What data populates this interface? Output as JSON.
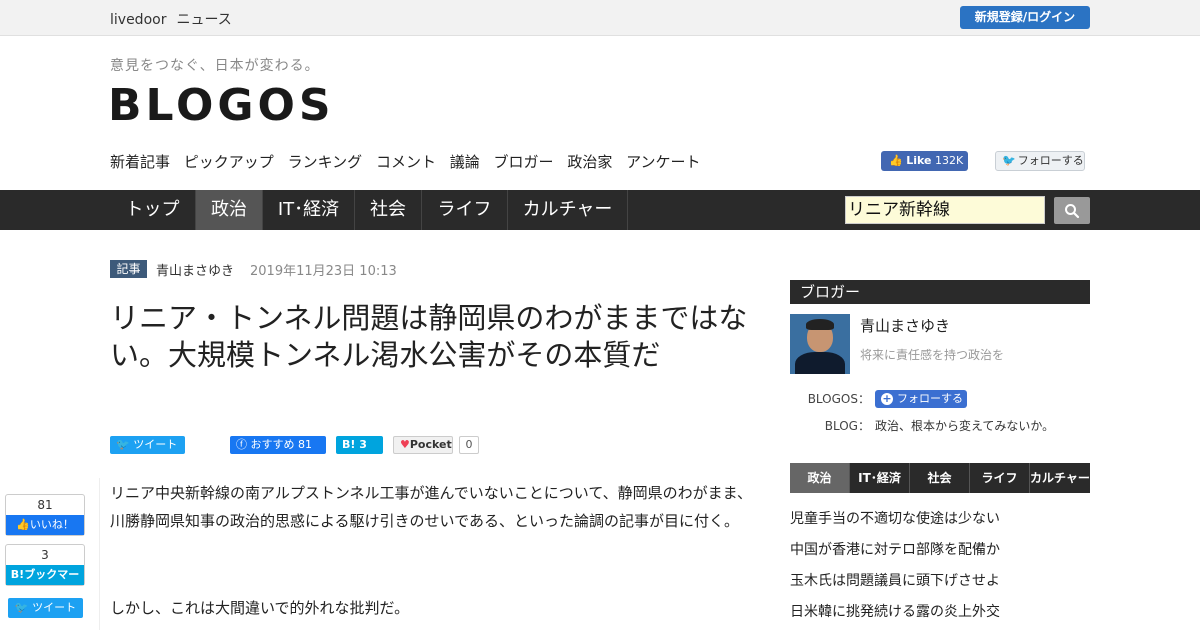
{
  "topbar": {
    "brand": "livedoor",
    "brand_sub": "ニュース",
    "login": "新規登録/ログイン"
  },
  "header": {
    "tagline": "意見をつなぐ、日本が変わる。",
    "logo": "BLOGOS",
    "nav": [
      "新着記事",
      "ピックアップ",
      "ランキング",
      "コメント",
      "議論",
      "ブロガー",
      "政治家",
      "アンケート"
    ],
    "fb_like_label": "Like",
    "fb_like_count": "132K",
    "tw_follow": "フォローする"
  },
  "categories": [
    "トップ",
    "政治",
    "IT･経済",
    "社会",
    "ライフ",
    "カルチャー"
  ],
  "search": {
    "value": "リニア新幹線"
  },
  "article": {
    "tag": "記事",
    "author": "青山まさゆき",
    "date": "2019年11月23日 10:13",
    "title": "リニア・トンネル問題は静岡県のわがままではない。大規模トンネル渇水公害がその本質だ",
    "share": {
      "tweet": "ツイート",
      "fb": "おすすめ",
      "fb_count": "81",
      "hatena_count": "3",
      "pocket": "Pocket",
      "pocket_count": "0"
    },
    "paragraphs": [
      "リニア中央新幹線の南アルプストンネル工事が進んでいないことについて、静岡県のわがまま、川勝静岡県知事の政治的思惑による駆け引きのせいである、といった論調の記事が目に付く。",
      "しかし、これは大間違いで的外れな批判だ。"
    ]
  },
  "float_share": {
    "like_count": "81",
    "like_label": "いいね！",
    "hatena_count": "3",
    "hatena_label": "ブックマーク",
    "tweet": "ツイート"
  },
  "sidebar": {
    "heading": "ブロガー",
    "blogger_name": "青山まさゆき",
    "blogger_desc": "将来に責任感を持つ政治を",
    "blogos_label": "BLOGOS：",
    "follow_label": "フォローする",
    "blog_label": "BLOG：",
    "blog_title": "政治、根本から変えてみないか。",
    "tabs": [
      "政治",
      "IT･経済",
      "社会",
      "ライフ",
      "カルチャー"
    ],
    "news": [
      "児童手当の不適切な使途は少ない",
      "中国が香港に対テロ部隊を配備か",
      "玉木氏は問題議員に頭下げさせよ",
      "日米韓に挑発続ける露の炎上外交"
    ]
  },
  "colors": {
    "accent_blue": "#2b73c3",
    "dark_bar": "#2a2a2a",
    "twitter": "#1da1f2",
    "facebook": "#1877f2",
    "hatena": "#00a4de"
  }
}
